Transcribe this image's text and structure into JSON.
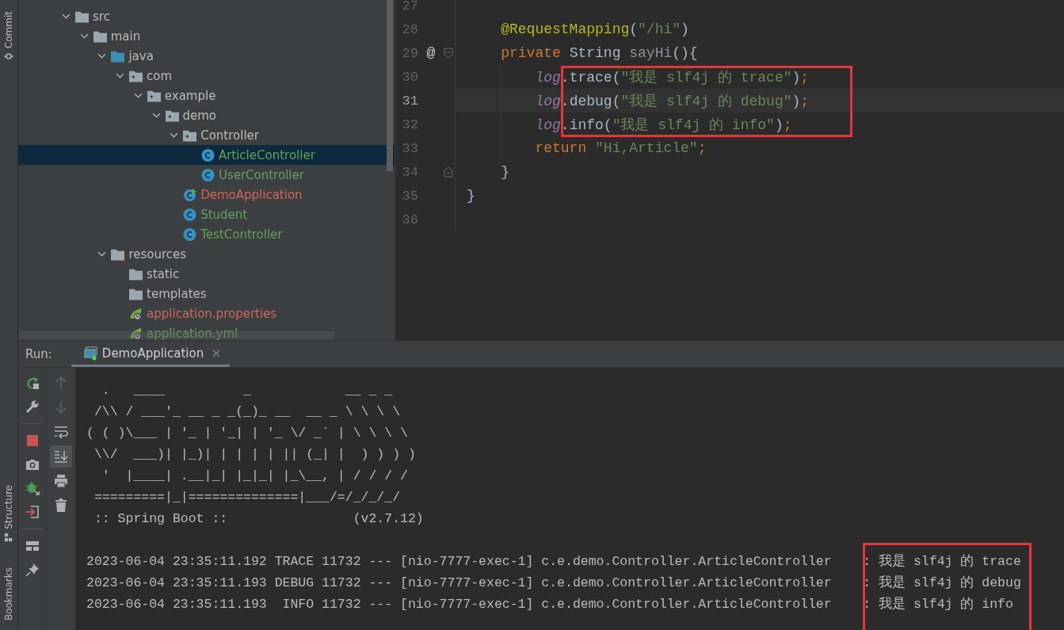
{
  "side_tabs": [
    {
      "label": "Commit",
      "kind": "commit"
    },
    {
      "label": "Structure",
      "kind": "structure"
    },
    {
      "label": "Bookmarks",
      "kind": "bookmarks"
    }
  ],
  "project_tree": [
    {
      "label": "src",
      "kind": "folder",
      "color": "#bbbbbb",
      "selected": false,
      "expanded": true,
      "children": [
        {
          "label": "main",
          "kind": "folder",
          "color": "#bbbbbb",
          "selected": false,
          "expanded": true,
          "children": [
            {
              "label": "java",
              "kind": "source-folder",
              "color": "#bbbbbb",
              "selected": false,
              "expanded": true,
              "children": [
                {
                  "label": "com",
                  "kind": "package",
                  "color": "#bbbbbb",
                  "selected": false,
                  "expanded": true,
                  "children": [
                    {
                      "label": "example",
                      "kind": "package",
                      "color": "#bbbbbb",
                      "selected": false,
                      "expanded": true,
                      "children": [
                        {
                          "label": "demo",
                          "kind": "package",
                          "color": "#bbbbbb",
                          "selected": false,
                          "expanded": true,
                          "children": [
                            {
                              "label": "Controller",
                              "kind": "package",
                              "color": "#bbbbbb",
                              "selected": false,
                              "expanded": true,
                              "children": [
                                {
                                  "label": "ArticleController",
                                  "kind": "class",
                                  "color": "#62a35a",
                                  "selected": true
                                },
                                {
                                  "label": "UserController",
                                  "kind": "class",
                                  "color": "#62a35a",
                                  "selected": false
                                }
                              ]
                            },
                            {
                              "label": "DemoApplication",
                              "kind": "main-class",
                              "color": "#d1675a",
                              "selected": false
                            },
                            {
                              "label": "Student",
                              "kind": "class",
                              "color": "#62a35a",
                              "selected": false
                            },
                            {
                              "label": "TestController",
                              "kind": "class",
                              "color": "#62a35a",
                              "selected": false
                            }
                          ]
                        }
                      ]
                    }
                  ]
                }
              ]
            },
            {
              "label": "resources",
              "kind": "resources-folder",
              "color": "#bbbbbb",
              "selected": false,
              "expanded": true,
              "children": [
                {
                  "label": "static",
                  "kind": "folder",
                  "color": "#bbbbbb",
                  "selected": false
                },
                {
                  "label": "templates",
                  "kind": "folder",
                  "color": "#bbbbbb",
                  "selected": false
                },
                {
                  "label": "application.properties",
                  "kind": "spring-config",
                  "color": "#d1675a",
                  "selected": false
                },
                {
                  "label": "application.yml",
                  "kind": "spring-config",
                  "color": "#62a35a",
                  "selected": false
                }
              ]
            }
          ]
        }
      ]
    }
  ],
  "editor": {
    "lines": [
      {
        "number": "27",
        "kind": "plain",
        "current": false,
        "framed": false
      },
      {
        "number": "28",
        "kind": "plain",
        "current": false,
        "framed": false,
        "tokens": [
          {
            "text": "    @RequestMapping",
            "kind": "annotation"
          },
          {
            "text": "(",
            "kind": "plain"
          },
          {
            "text": "\"/hi\"",
            "kind": "string"
          },
          {
            "text": ")",
            "kind": "plain"
          }
        ]
      },
      {
        "number": "29",
        "current": false,
        "framed": false,
        "gutter": "@",
        "kind": "fold-start",
        "tokens": [
          {
            "text": "    private",
            "kind": "keyword"
          },
          {
            "text": " String ",
            "kind": "plain"
          },
          {
            "text": "sayHi",
            "kind": "unused"
          },
          {
            "text": "(){",
            "kind": "plain"
          }
        ]
      },
      {
        "number": "30",
        "kind": "plain",
        "current": false,
        "framed": true,
        "tokens": [
          {
            "text": "        log",
            "kind": "field"
          },
          {
            "text": ".trace(",
            "kind": "plain"
          },
          {
            "text": "\"我是 slf4j 的 trace\"",
            "kind": "string"
          },
          {
            "text": ")",
            "kind": "plain"
          },
          {
            "text": ";",
            "kind": "separator"
          }
        ]
      },
      {
        "number": "31",
        "kind": "plain",
        "current": true,
        "framed": true,
        "tokens": [
          {
            "text": "        log",
            "kind": "field"
          },
          {
            "text": ".debug(",
            "kind": "plain"
          },
          {
            "text": "\"我是 slf4j 的 debug\"",
            "kind": "string"
          },
          {
            "text": ")",
            "kind": "plain"
          },
          {
            "text": ";",
            "kind": "separator"
          }
        ]
      },
      {
        "number": "32",
        "kind": "plain",
        "current": false,
        "framed": true,
        "tokens": [
          {
            "text": "        log",
            "kind": "field"
          },
          {
            "text": ".info(",
            "kind": "plain"
          },
          {
            "text": "\"我是 slf4j 的 info\"",
            "kind": "string"
          },
          {
            "text": ")",
            "kind": "plain"
          },
          {
            "text": ";",
            "kind": "separator"
          }
        ]
      },
      {
        "number": "33",
        "kind": "plain",
        "current": false,
        "framed": false,
        "tokens": [
          {
            "text": "        return",
            "kind": "keyword"
          },
          {
            "text": " \"Hi,Article\"",
            "kind": "string"
          },
          {
            "text": ";",
            "kind": "separator"
          }
        ]
      },
      {
        "number": "34",
        "current": false,
        "framed": false,
        "kind": "fold-end",
        "tokens": [
          {
            "text": "    }",
            "kind": "plain"
          }
        ]
      },
      {
        "number": "35",
        "kind": "plain",
        "current": false,
        "framed": false,
        "tokens": [
          {
            "text": "}",
            "kind": "plain"
          }
        ]
      },
      {
        "number": "36",
        "kind": "plain",
        "current": false,
        "framed": false
      }
    ]
  },
  "run_panel": {
    "label": "Run:",
    "tabs": [
      {
        "label": "DemoApplication",
        "selected": true,
        "close": "×"
      }
    ],
    "actions": [
      {
        "kind": "rerun"
      },
      {
        "kind": "settings"
      },
      {
        "kind": "separator"
      },
      {
        "kind": "stop"
      },
      {
        "kind": "camera"
      },
      {
        "kind": "bug"
      },
      {
        "kind": "exit"
      },
      {
        "kind": "separator"
      },
      {
        "kind": "layout"
      },
      {
        "kind": "pin"
      }
    ],
    "console_tools": [
      {
        "kind": "up",
        "disabled": true,
        "on": false
      },
      {
        "kind": "down",
        "disabled": true,
        "on": false
      },
      {
        "kind": "wrap",
        "disabled": false,
        "on": false
      },
      {
        "kind": "scroll-end",
        "disabled": false,
        "on": true
      },
      {
        "kind": "print",
        "disabled": false,
        "on": false
      },
      {
        "kind": "trash",
        "disabled": false,
        "on": false
      }
    ],
    "console": [
      {
        "kind": "banner",
        "text": "  .   ____          _            __ _ _",
        "framed": false
      },
      {
        "kind": "banner",
        "text": " /\\\\ / ___'_ __ _ _(_)_ __  __ _ \\ \\ \\ \\",
        "framed": false
      },
      {
        "kind": "banner",
        "text": "( ( )\\___ | '_ | '_| | '_ \\/ _` | \\ \\ \\ \\",
        "framed": false
      },
      {
        "kind": "banner",
        "text": " \\\\/  ___)| |_)| | | | | || (_| |  ) ) ) )",
        "framed": false
      },
      {
        "kind": "banner",
        "text": "  '  |____| .__|_| |_|_| |_\\__, | / / / /",
        "framed": false
      },
      {
        "kind": "banner",
        "text": " =========|_|==============|___/=/_/_/_/",
        "framed": false
      },
      {
        "kind": "banner",
        "text": " :: Spring Boot ::                (v2.7.12)",
        "framed": false
      },
      {
        "kind": "log",
        "text": "2023-06-04 23:35:11.192 TRACE 11732 --- [nio-7777-exec-1] c.e.demo.Controller.ArticleController    : 我是 slf4j 的 trace",
        "framed": true
      },
      {
        "kind": "log",
        "text": "2023-06-04 23:35:11.193 DEBUG 11732 --- [nio-7777-exec-1] c.e.demo.Controller.ArticleController    : 我是 slf4j 的 debug",
        "framed": true
      },
      {
        "kind": "log",
        "text": "2023-06-04 23:35:11.193  INFO 11732 --- [nio-7777-exec-1] c.e.demo.Controller.ArticleController    : 我是 slf4j 的 info",
        "framed": true
      }
    ]
  }
}
